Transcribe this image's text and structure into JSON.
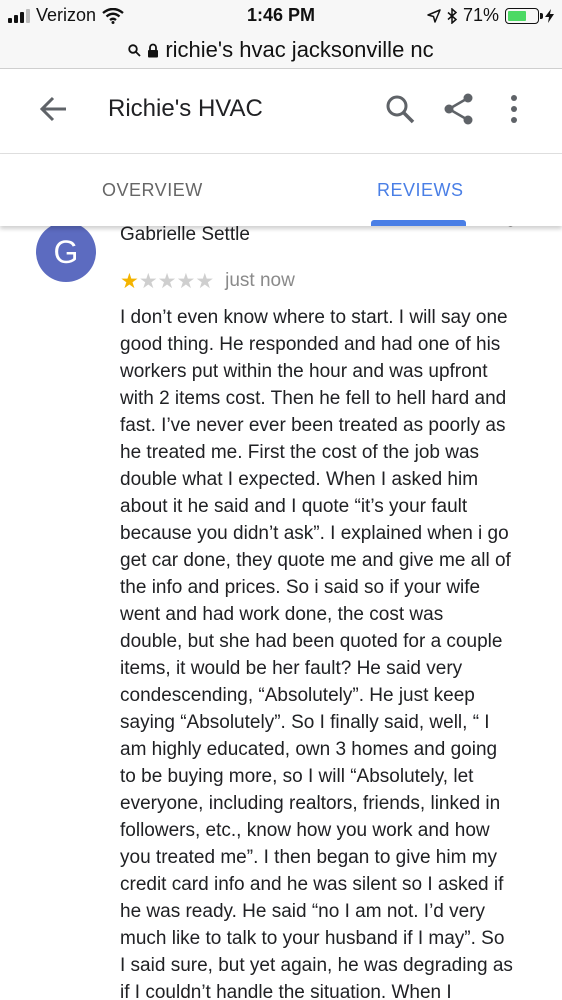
{
  "status_bar": {
    "carrier": "Verizon",
    "time": "1:46 PM",
    "battery_percent": "71%",
    "battery_level": 0.71,
    "icons": [
      "signal-icon",
      "wifi-icon",
      "location-arrow-icon",
      "bluetooth-icon",
      "battery-icon",
      "charging-icon"
    ]
  },
  "url_bar": {
    "text": "richie's hvac jacksonville nc",
    "icons": [
      "search-icon",
      "lock-icon"
    ]
  },
  "header": {
    "title": "Richie's HVAC",
    "icons": [
      "back-arrow-icon",
      "search-icon",
      "share-icon",
      "more-vert-icon"
    ]
  },
  "tabs": {
    "items": [
      {
        "label": "OVERVIEW",
        "active": false
      },
      {
        "label": "REVIEWS",
        "active": true
      }
    ],
    "accent_color": "#4a7fe6"
  },
  "review": {
    "avatar_letter": "G",
    "avatar_color": "#5c6bc0",
    "reviewer_name": "Gabrielle Settle",
    "rating": 1,
    "max_rating": 5,
    "star_color": "#f4b400",
    "time": "just now",
    "text_lines": [
      "I don’t even know where to start. I will say one",
      "good thing. He responded and had one of his",
      "workers put within the hour and was upfront",
      "with 2 items cost. Then he fell to hell hard and",
      "fast. I’ve never ever been treated as poorly as",
      "he treated me. First the cost of the job was",
      "double what I expected. When I asked him",
      "about it he said and I quote “it’s your fault",
      "because you didn’t ask”. I explained when i go",
      "get car done, they quote me and give me all of",
      "the info and prices. So i said so if your wife",
      "went and had work done, the cost was",
      "double, but she had been quoted for a couple",
      "items, it would be her fault?  He said very",
      "condescending, “Absolutely”. He just keep",
      "saying “Absolutely”. So I finally said, well, “ I",
      "am highly educated, own 3 homes and going",
      "to be buying more, so I will “Absolutely, let",
      "everyone, including realtors, friends, linked in",
      "followers, etc., know how you work and how",
      "you treated me”. I then began to give him my",
      "credit card info and he was silent so I asked if",
      "he was ready. He said “no I am not. I’d very",
      "much like to talk to your husband if I may”. So",
      "I said sure, but yet again, he was degrading as",
      "if I couldn’t handle the situation.  When I"
    ]
  }
}
